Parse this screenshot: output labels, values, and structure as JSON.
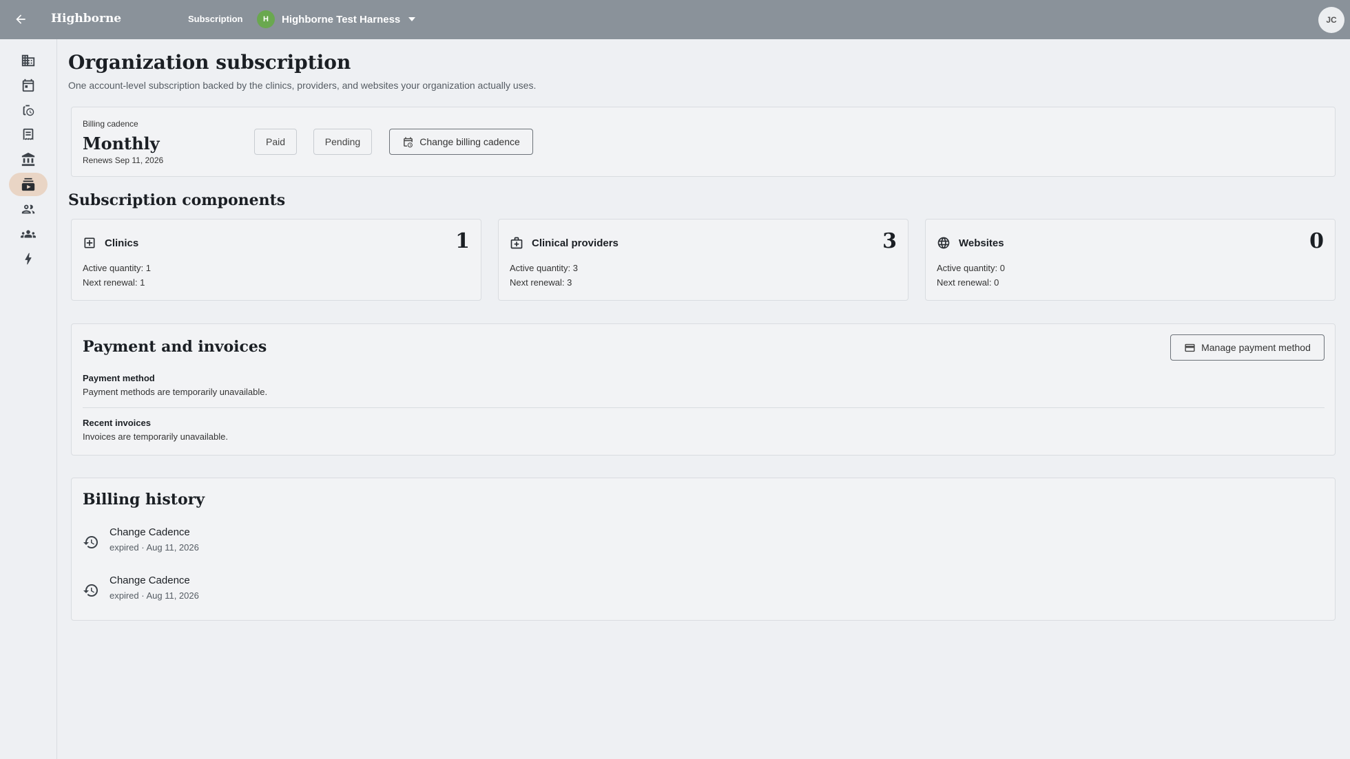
{
  "header": {
    "brand": "Highborne",
    "nav_current": "Subscription",
    "org_initial": "H",
    "org_name": "Highborne Test Harness",
    "user_initials": "JC"
  },
  "sidebar": {
    "items": [
      {
        "icon": "building-icon"
      },
      {
        "icon": "calendar-icon"
      },
      {
        "icon": "time-tracking-icon"
      },
      {
        "icon": "receipt-icon"
      },
      {
        "icon": "bank-icon"
      },
      {
        "icon": "subscription-icon",
        "active": true
      },
      {
        "icon": "people-icon"
      },
      {
        "icon": "groups-icon"
      },
      {
        "icon": "bolt-icon"
      }
    ]
  },
  "page": {
    "title": "Organization subscription",
    "subtitle": "One account-level subscription backed by the clinics, providers, and websites your organization actually uses."
  },
  "billing": {
    "label": "Billing cadence",
    "value": "Monthly",
    "renews": "Renews Sep 11, 2026",
    "paid_label": "Paid",
    "pending_label": "Pending",
    "change_label": "Change billing cadence"
  },
  "components": {
    "title": "Subscription components",
    "items": [
      {
        "name": "Clinics",
        "count": "1",
        "active": "Active quantity: 1",
        "renewal": "Next renewal: 1",
        "icon": "clinic-plus-icon"
      },
      {
        "name": "Clinical providers",
        "count": "3",
        "active": "Active quantity: 3",
        "renewal": "Next renewal: 3",
        "icon": "medical-bag-icon"
      },
      {
        "name": "Websites",
        "count": "0",
        "active": "Active quantity: 0",
        "renewal": "Next renewal: 0",
        "icon": "globe-icon"
      }
    ]
  },
  "payment": {
    "title": "Payment and invoices",
    "manage_label": "Manage payment method",
    "method_label": "Payment method",
    "method_text": "Payment methods are temporarily unavailable.",
    "invoices_label": "Recent invoices",
    "invoices_text": "Invoices are temporarily unavailable."
  },
  "history": {
    "title": "Billing history",
    "items": [
      {
        "name": "Change Cadence",
        "meta": "expired · Aug 11, 2026"
      },
      {
        "name": "Change Cadence",
        "meta": "expired · Aug 11, 2026"
      }
    ]
  },
  "colors": {
    "topbar": "#8a929a",
    "background": "#eef0f3",
    "active_nav": "#e9d5c5",
    "org_avatar": "#6aa84f"
  }
}
